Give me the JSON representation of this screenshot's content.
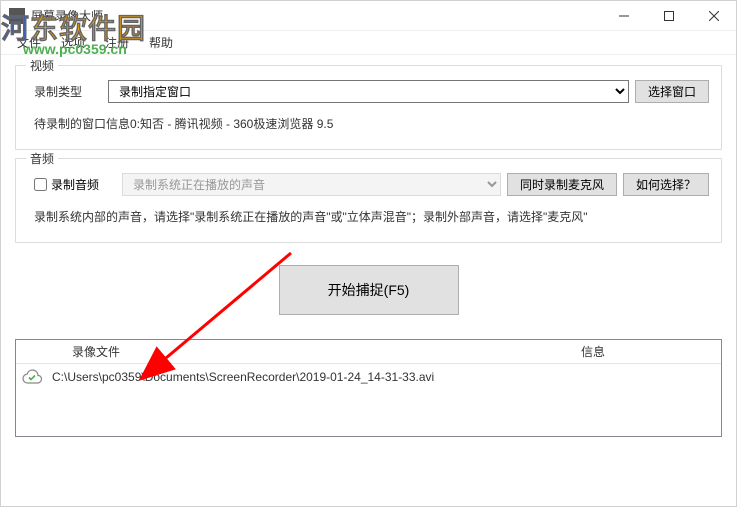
{
  "window": {
    "title": "屏幕录像大师",
    "watermark_text": "河东软件园",
    "watermark_url": "www.pc0359.cn"
  },
  "menu": {
    "file": "文件",
    "options": "选项",
    "register": "注册",
    "help": "帮助"
  },
  "video": {
    "group_title": "视频",
    "type_label": "录制类型",
    "type_value": "录制指定窗口",
    "select_window_btn": "选择窗口",
    "window_info": "待录制的窗口信息0:知否 - 腾讯视频 - 360极速浏览器 9.5"
  },
  "audio": {
    "group_title": "音频",
    "record_label": "录制音频",
    "source_value": "录制系统正在播放的声音",
    "record_mic_btn": "同时录制麦克风",
    "how_to_btn": "如何选择？",
    "hint": "录制系统内部的声音，请选择\"录制系统正在播放的声音\"或\"立体声混音\"；录制外部声音，请选择\"麦克风\""
  },
  "capture": {
    "button_label": "开始捕捉(F5)"
  },
  "list": {
    "col_file": "录像文件",
    "col_info": "信息",
    "rows": [
      {
        "path": "C:\\Users\\pc0359\\Documents\\ScreenRecorder\\2019-01-24_14-31-33.avi",
        "info": ""
      }
    ]
  }
}
